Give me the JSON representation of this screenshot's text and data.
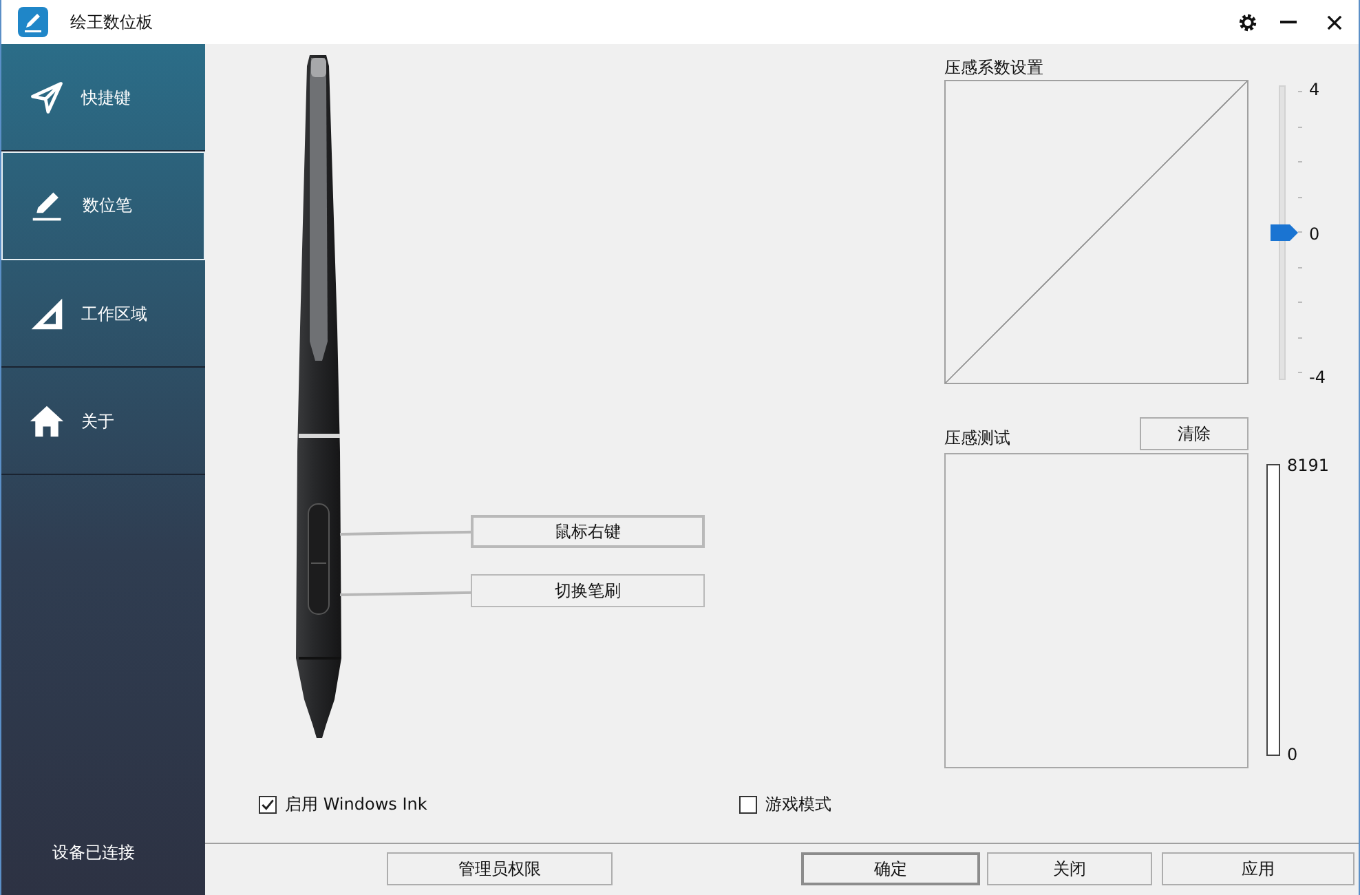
{
  "window": {
    "title": "绘王数位板"
  },
  "sidebar": {
    "items": [
      {
        "label": "快捷键",
        "selected": false,
        "kind": "shortcut"
      },
      {
        "label": "数位笔",
        "selected": true,
        "kind": "pen"
      },
      {
        "label": "工作区域",
        "selected": false,
        "kind": "area"
      },
      {
        "label": "关于",
        "selected": false,
        "kind": "about"
      }
    ],
    "status": "设备已连接"
  },
  "pen": {
    "buttons": [
      {
        "label": "鼠标右键"
      },
      {
        "label": "切换笔刷"
      }
    ]
  },
  "options": [
    {
      "label": "启用 Windows Ink",
      "checked": true
    },
    {
      "label": "游戏模式",
      "checked": false
    }
  ],
  "pressure_curve": {
    "title": "压感系数设置",
    "slider": {
      "level": 0.5,
      "max_label": "4",
      "mid_label": "0",
      "min_label": "-4"
    }
  },
  "pressure_test": {
    "title": "压感测试",
    "clear_button": "清除",
    "meter": {
      "level": 0,
      "max_label": "8191",
      "min_label": "0"
    }
  },
  "footer": {
    "buttons": [
      {
        "label": "管理员权限",
        "default": false
      },
      {
        "label": "确定",
        "default": true
      },
      {
        "label": "关闭",
        "default": false
      },
      {
        "label": "应用",
        "default": false
      }
    ]
  }
}
